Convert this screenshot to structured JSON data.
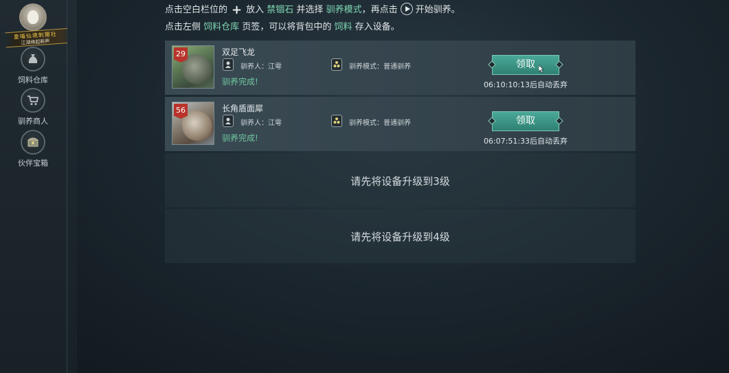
{
  "logo": {
    "line1": "皇喵仙境刺猬社",
    "line2": "江湖缘起新声"
  },
  "sidebar": {
    "items": [
      {
        "label": "饲料仓库",
        "icon": "feed-bag-icon"
      },
      {
        "label": "驯养商人",
        "icon": "shopping-cart-icon"
      },
      {
        "label": "伙伴宝箱",
        "icon": "treasure-chest-icon"
      }
    ]
  },
  "hints": {
    "line1": {
      "a": "点击空白栏位的",
      "b": "放入",
      "c": "禁锢石",
      "d": "并选择",
      "e": "驯养模式",
      "f": "，再点击",
      "g": "开始驯养。"
    },
    "line2": {
      "a": "点击左侧",
      "b": "饲料仓库",
      "c": "页签，可以将背包中的",
      "d": "饲料",
      "e": "存入设备。"
    }
  },
  "slots": [
    {
      "level": "29",
      "name": "双足飞龙",
      "tamer_label": "驯养人：江雩",
      "mode_label": "驯养模式：普通驯养",
      "status": "驯养完成!",
      "button": "领取",
      "timer": "06:10:10:13后自动丢弃"
    },
    {
      "level": "56",
      "name": "长角盾面犀",
      "tamer_label": "驯养人：江雩",
      "mode_label": "驯养模式：普通驯养",
      "status": "驯养完成!",
      "button": "领取",
      "timer": "06:07:51:33后自动丢弃"
    }
  ],
  "locked": [
    {
      "message": "请先将设备升级到3级"
    },
    {
      "message": "请先将设备升级到4级"
    }
  ],
  "colors": {
    "accent": "#7fd6b2",
    "button": "#3a9585",
    "level_badge": "#b8342c"
  }
}
